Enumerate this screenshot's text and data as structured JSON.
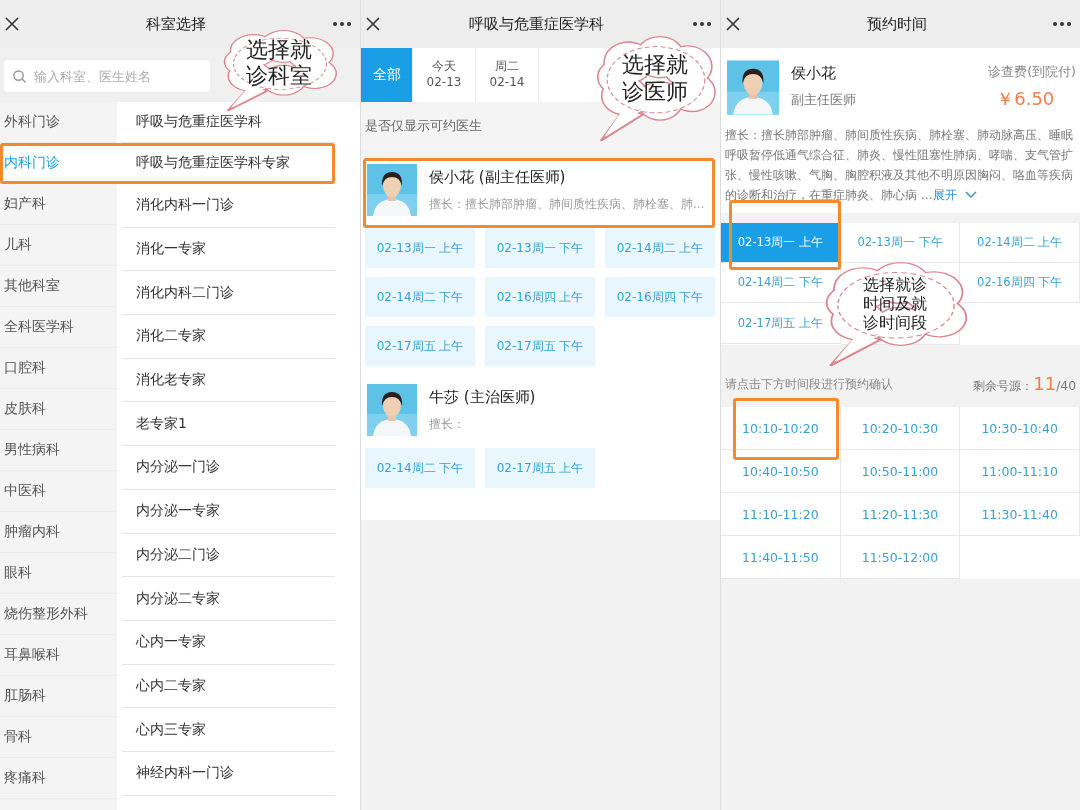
{
  "department_screen": {
    "header": {
      "title": "科室选择"
    },
    "search": {
      "placeholder": "输入科室、医生姓名"
    },
    "categories": [
      {
        "label": "外科门诊",
        "selected": false
      },
      {
        "label": "内科门诊",
        "selected": true
      },
      {
        "label": "妇产科",
        "selected": false
      },
      {
        "label": "儿科",
        "selected": false
      },
      {
        "label": "其他科室",
        "selected": false
      },
      {
        "label": "全科医学科",
        "selected": false
      },
      {
        "label": "口腔科",
        "selected": false
      },
      {
        "label": "皮肤科",
        "selected": false
      },
      {
        "label": "男性病科",
        "selected": false
      },
      {
        "label": "中医科",
        "selected": false
      },
      {
        "label": "肿瘤内科",
        "selected": false
      },
      {
        "label": "眼科",
        "selected": false
      },
      {
        "label": "烧伤整形外科",
        "selected": false
      },
      {
        "label": "耳鼻喉科",
        "selected": false
      },
      {
        "label": "肛肠科",
        "selected": false
      },
      {
        "label": "骨科",
        "selected": false
      },
      {
        "label": "疼痛科",
        "selected": false
      }
    ],
    "departments": [
      {
        "label": "呼吸与危重症医学科",
        "selected": false
      },
      {
        "label": "呼吸与危重症医学科专家",
        "selected": false
      },
      {
        "label": "消化内科一门诊",
        "selected": false
      },
      {
        "label": "消化一专家",
        "selected": false
      },
      {
        "label": "消化内科二门诊",
        "selected": false
      },
      {
        "label": "消化二专家",
        "selected": false
      },
      {
        "label": "消化老专家",
        "selected": false
      },
      {
        "label": "老专家1",
        "selected": false
      },
      {
        "label": "内分泌一门诊",
        "selected": false
      },
      {
        "label": "内分泌一专家",
        "selected": false
      },
      {
        "label": "内分泌二门诊",
        "selected": false
      },
      {
        "label": "内分泌二专家",
        "selected": false
      },
      {
        "label": "心内一专家",
        "selected": false
      },
      {
        "label": "心内二专家",
        "selected": false
      },
      {
        "label": "心内三专家",
        "selected": false
      },
      {
        "label": "神经内科一门诊",
        "selected": false
      }
    ],
    "callout": {
      "text": "选择就诊科室"
    }
  },
  "doctor_screen": {
    "header": {
      "title": "呼吸与危重症医学科"
    },
    "date_tabs": [
      {
        "label": "全部",
        "selected": true
      },
      {
        "day": "今天",
        "date": "02-13",
        "selected": false
      },
      {
        "day": "周二",
        "date": "02-14",
        "selected": false
      }
    ],
    "filter": {
      "label": "是否仅显示可约医生"
    },
    "doctors": [
      {
        "name": "侯小花 (副主任医师)",
        "specialty": "擅长：擅长肺部肿瘤、肺间质性疾病、肺栓塞、肺…",
        "slots": [
          {
            "label": "02-13周一 上午"
          },
          {
            "label": "02-13周一 下午"
          },
          {
            "label": "02-14周二 上午"
          },
          {
            "label": "02-14周二 下午"
          },
          {
            "label": "02-16周四 上午"
          },
          {
            "label": "02-16周四 下午"
          },
          {
            "label": "02-17周五 上午"
          },
          {
            "label": "02-17周五 下午"
          }
        ]
      },
      {
        "name": "牛莎 (主治医师)",
        "specialty": "擅长：",
        "slots": [
          {
            "label": "02-14周二 下午"
          },
          {
            "label": "02-17周五 上午"
          }
        ]
      }
    ],
    "callout": {
      "text": "选择就诊医师"
    }
  },
  "time_screen": {
    "header": {
      "title": "预约时间"
    },
    "doctor": {
      "name": "侯小花",
      "title": "副主任医师",
      "fee_label": "诊查费(到院付)",
      "fee": "￥6.50",
      "specialty": "擅长：擅长肺部肿瘤、肺间质性疾病、肺栓塞、肺动脉高压、睡眠呼吸暂停低通气综合征、肺炎、慢性阻塞性肺病、哮喘、支气管扩张、慢性咳嗽、气胸、胸腔积液及其他不明原因胸闷、咯血等疾病的诊断和治疗，在重症肺炎、肺心病 ...",
      "expand_link": "展开"
    },
    "dates": [
      {
        "kind": "slot",
        "label": "02-13周一 上午",
        "selected": true
      },
      {
        "kind": "slot",
        "label": "02-13周一 下午",
        "selected": false
      },
      {
        "kind": "slot",
        "label": "02-14周二 上午",
        "selected": false
      },
      {
        "kind": "slot",
        "label": "02-14周二 下午",
        "selected": false
      },
      {
        "kind": "covered"
      },
      {
        "kind": "slot",
        "label": "02-16周四 下午",
        "selected": false
      },
      {
        "kind": "slot",
        "label": "02-17周五 上午",
        "selected": false
      },
      {
        "kind": "covered"
      }
    ],
    "note": "请点击下方时间段进行预约确认",
    "remaining": {
      "label": "剩余号源：",
      "count": "11",
      "total": "/40"
    },
    "times": [
      {
        "label": "10:10-10:20",
        "selected": false
      },
      {
        "label": "10:20-10:30",
        "selected": false
      },
      {
        "label": "10:30-10:40",
        "selected": false
      },
      {
        "label": "10:40-10:50",
        "selected": false
      },
      {
        "label": "10:50-11:00",
        "selected": false
      },
      {
        "label": "11:00-11:10",
        "selected": false
      },
      {
        "label": "11:10-11:20",
        "selected": false
      },
      {
        "label": "11:20-11:30",
        "selected": false
      },
      {
        "label": "11:30-11:40",
        "selected": false
      },
      {
        "label": "11:40-11:50",
        "selected": false
      },
      {
        "label": "11:50-12:00",
        "selected": false
      }
    ],
    "callout": {
      "text": "选择就诊时间及就诊时间段"
    }
  }
}
